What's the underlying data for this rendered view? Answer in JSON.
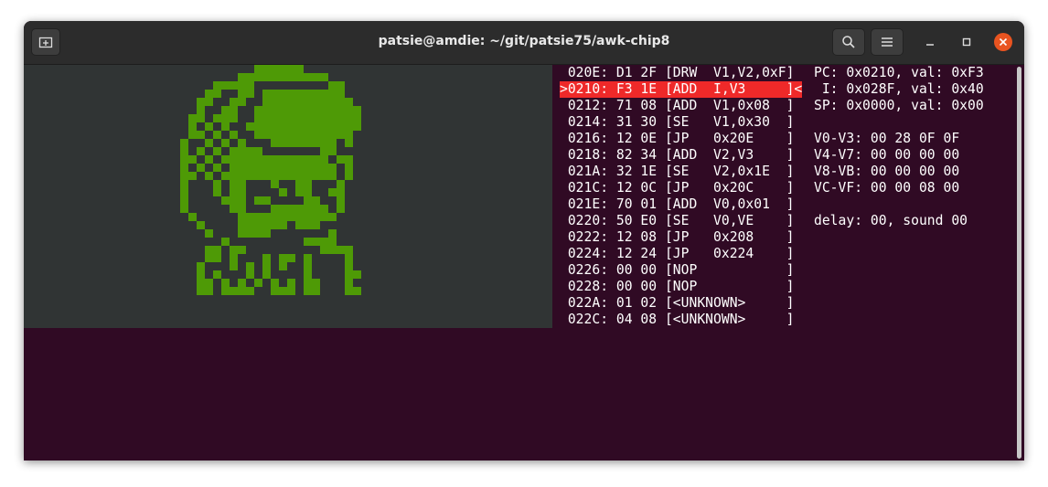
{
  "window": {
    "title": "patsie@amdie: ~/git/patsie75/awk-chip8",
    "new_tab_icon": "new-tab-icon",
    "search_icon": "search-icon",
    "menu_icon": "hamburger-menu-icon",
    "minimize_icon": "minimize-icon",
    "maximize_icon": "maximize-icon",
    "close_icon": "close-icon",
    "close_color": "#e95420"
  },
  "terminal": {
    "background": "#300a24",
    "screen_background": "#303434",
    "pixel_color": "#4e9a06",
    "highlight_color": "#ef2929"
  },
  "disassembly": [
    {
      "text": " 020E: D1 2F [DRW  V1,V2,0xF]",
      "current": false
    },
    {
      "text": ">0210: F3 1E [ADD  I,V3     ]<",
      "current": true
    },
    {
      "text": " 0212: 71 08 [ADD  V1,0x08  ]",
      "current": false
    },
    {
      "text": " 0214: 31 30 [SE   V1,0x30  ]",
      "current": false
    },
    {
      "text": " 0216: 12 0E [JP   0x20E    ]",
      "current": false
    },
    {
      "text": " 0218: 82 34 [ADD  V2,V3    ]",
      "current": false
    },
    {
      "text": " 021A: 32 1E [SE   V2,0x1E  ]",
      "current": false
    },
    {
      "text": " 021C: 12 0C [JP   0x20C    ]",
      "current": false
    },
    {
      "text": " 021E: 70 01 [ADD  V0,0x01  ]",
      "current": false
    },
    {
      "text": " 0220: 50 E0 [SE   V0,VE    ]",
      "current": false
    },
    {
      "text": " 0222: 12 08 [JP   0x208    ]",
      "current": false
    },
    {
      "text": " 0224: 12 24 [JP   0x224    ]",
      "current": false
    },
    {
      "text": " 0226: 00 00 [NOP           ]",
      "current": false
    },
    {
      "text": " 0228: 00 00 [NOP           ]",
      "current": false
    },
    {
      "text": " 022A: 01 02 [<UNKNOWN>     ]",
      "current": false
    },
    {
      "text": " 022C: 04 08 [<UNKNOWN>     ]",
      "current": false
    }
  ],
  "registers": [
    "PC: 0x0210, val: 0xF3",
    " I: 0x028F, val: 0x40",
    "SP: 0x0000, val: 0x00",
    "",
    "V0-V3: 00 28 0F 0F",
    "V4-V7: 00 00 00 00",
    "V8-VB: 00 00 00 00",
    "VC-VF: 00 00 08 00",
    "",
    "delay: 00, sound 00"
  ],
  "sprite_rows": [
    "..........######...........",
    "........###########........",
    ".....#####.........##......",
    "....##..##.##########......",
    "...##..##..###########.....",
    "...#..##..#############....",
    "..##.###..#############....",
    "..#.#.#..##############....",
    "..##.#.#..############.....",
    ".#..#.#.#...########.#.....",
    ".#.#.#.####.......##.......",
    ".##.#.#############.##.....",
    ".#.#.#.#############.#.....",
    ".##.#.##############.#.....",
    ".#...#.##...#..##...#......",
    ".#...#.##....#.##..##......",
    ".#....###.##....##..#......",
    ".#.....##...#######.#......",
    "..#.....############.......",
    "...#....######.###.........",
    "....#...####.......#.......",
    "......#.........####.......",
    "....##.##.........####.....",
    "....##.#...#.##.#....#.....",
    "...#...#.#.#.#..#....#.....",
    "...#.#...#.#....#....##....",
    "...##.#.#.#.#.#.##...#.....",
    "...##.####..###.##...##...."
  ]
}
